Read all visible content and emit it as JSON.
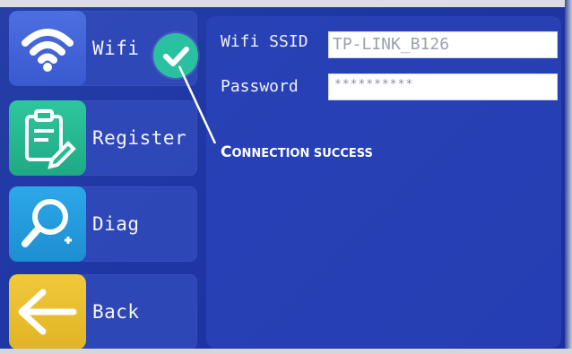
{
  "menu": {
    "items": [
      {
        "label": "Wifi",
        "icon": "wifi-icon"
      },
      {
        "label": "Register",
        "icon": "clipboard-edit-icon"
      },
      {
        "label": "Diag",
        "icon": "magnifier-icon"
      },
      {
        "label": "Back",
        "icon": "arrow-left-icon"
      }
    ],
    "wifi_status_icon": "checkmark-icon"
  },
  "wifi_form": {
    "ssid_label": "Wifi SSID",
    "ssid_value": "TP-LINK_B126",
    "password_label": "Password",
    "password_value": "**********"
  },
  "annotation": {
    "text_first": "C",
    "text_rest": "ONNECTION SUCCESS"
  },
  "colors": {
    "background": "#1e36a4",
    "wifi_tile": "#4566da",
    "register_tile": "#27bb93",
    "diag_tile": "#259cdc",
    "back_tile": "#e8bf2f",
    "check_badge": "#29c1a0"
  }
}
